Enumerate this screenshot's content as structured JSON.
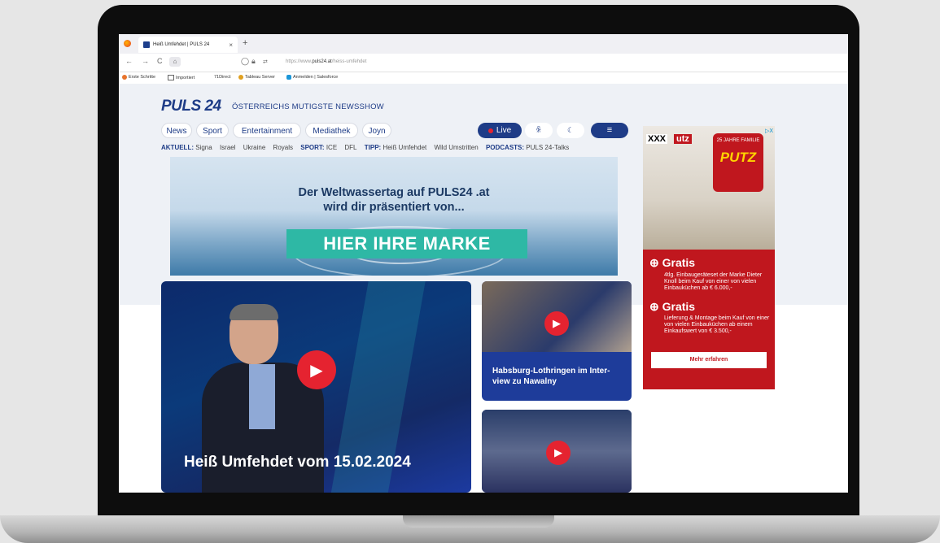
{
  "browser": {
    "tab_title": "Heiß Umfehdet | PULS 24",
    "new_tab": "+",
    "close": "×",
    "url_prefix": "https://www.",
    "url_domain": "puls24.at",
    "url_path": "/heiss-umfehdet",
    "bookmarks": [
      "Erste Schritte",
      "Importiert",
      "71Direct",
      "Tableau Server",
      "Anmelden | Salesforce"
    ]
  },
  "site": {
    "logo": "PULS 24",
    "tagline": "ÖSTERREICHS MUTIGSTE NEWSSHOW",
    "nav": [
      "News",
      "Sport",
      "Entertainment",
      "Mediathek",
      "Joyn"
    ],
    "live_label": "Live",
    "quicklinks": {
      "aktuell_label": "AKTUELL:",
      "aktuell": [
        "Signa",
        "Israel",
        "Ukraine",
        "Royals"
      ],
      "sport_label": "SPORT:",
      "sport": [
        "ICE",
        "DFL"
      ],
      "tipp_label": "TIPP:",
      "tipp": [
        "Heiß Umfehdet",
        "Wild Umstritten"
      ],
      "podcasts_label": "PODCASTS:",
      "podcasts": [
        "PULS 24-Talks"
      ]
    }
  },
  "banner": {
    "line1": "Der Weltwassertag auf PULS24 .at",
    "line2": "wird dir präsentiert von...",
    "brand": "HIER IHRE MARKE"
  },
  "hero": {
    "title": "Heiß Umfehdet vom 15.02.2024"
  },
  "cards": [
    {
      "caption": "Habsburg-Lothringen im Inter-view zu Nawalny"
    },
    {
      "caption": ""
    }
  ],
  "ad": {
    "brand_a": "XXX",
    "brand_b": "utz",
    "badge_top": "25 JAHRE FAMILIE",
    "badge_main": "PUTZ",
    "offer1_title": "Gratis",
    "offer1_text": "4tlg. Einbaugeräteset der Marke Dieter Knoll beim Kauf von einer von vielen Einbauküchen ab € 6.000,-",
    "offer2_title": "Gratis",
    "offer2_text": "Lieferung & Montage beim Kauf von einer von vielen Einbauküchen ab einem Einkaufswert von € 3.500,-",
    "button": "Mehr erfahren",
    "adx": "▷X"
  },
  "colors": {
    "brand_blue": "#1e3c87",
    "live_red": "#e42430",
    "marke_teal": "#2eb8a5",
    "ad_red": "#c0171e"
  }
}
